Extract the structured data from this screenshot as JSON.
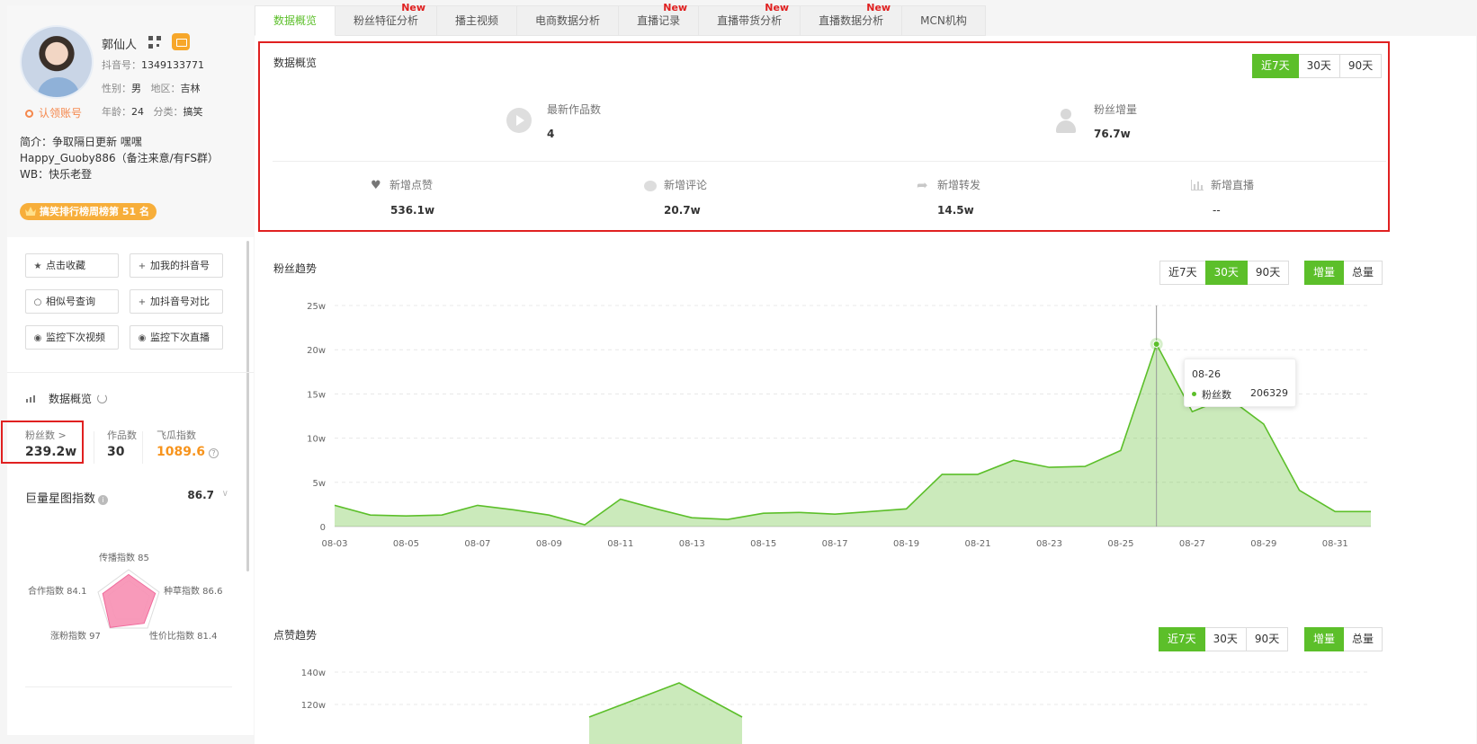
{
  "profile": {
    "name": "郭仙人",
    "douyin_id_label": "抖音号：",
    "douyin_id": "1349133771",
    "gender_label": "性别：",
    "gender": "男",
    "region_label": "地区：",
    "region": "吉林",
    "age_label": "年龄：",
    "age": "24",
    "category_label": "分类：",
    "category": "搞笑",
    "claim": "认领账号",
    "bio_lines": [
      "简介：争取隔日更新 嘿嘿",
      "Happy_Guoby886（备注来意/有FS群）",
      "WB：快乐老登"
    ],
    "rank_badge": "搞笑排行榜周榜第 51 名"
  },
  "actions": {
    "favorite": "点击收藏",
    "add_mine": "加我的抖音号",
    "similar": "相似号查询",
    "compare": "加抖音号对比",
    "monitor_video": "监控下次视频",
    "monitor_live": "监控下次直播"
  },
  "left_overview": {
    "title": "数据概览",
    "fans_label": "粉丝数 >",
    "fans_value": "239.2w",
    "works_label": "作品数",
    "works_value": "30",
    "feigua_label": "飞瓜指数",
    "feigua_value": "1089.6",
    "star_label": "巨量星图指数",
    "star_value": "86.7"
  },
  "radar": {
    "labels": {
      "spread": "传播指数 85",
      "grass": "种草指数 86.6",
      "value": "性价比指数 81.4",
      "growth": "涨粉指数 97",
      "coop": "合作指数 84.1"
    },
    "values": [
      85,
      86.6,
      81.4,
      97,
      84.1
    ]
  },
  "tabs": [
    {
      "label": "数据概览",
      "new": ""
    },
    {
      "label": "粉丝特征分析",
      "new": "New"
    },
    {
      "label": "播主视频",
      "new": ""
    },
    {
      "label": "电商数据分析",
      "new": ""
    },
    {
      "label": "直播记录",
      "new": "New"
    },
    {
      "label": "直播带货分析",
      "new": "New"
    },
    {
      "label": "直播数据分析",
      "new": "New"
    },
    {
      "label": "MCN机构",
      "new": ""
    }
  ],
  "overview": {
    "title": "数据概览",
    "ranges": [
      "近7天",
      "30天",
      "90天"
    ],
    "latest_works_label": "最新作品数",
    "latest_works_value": "4",
    "fans_growth_label": "粉丝增量",
    "fans_growth_value": "76.7w",
    "likes_label": "新增点赞",
    "likes_value": "536.1w",
    "comments_label": "新增评论",
    "comments_value": "20.7w",
    "shares_label": "新增转发",
    "shares_value": "14.5w",
    "live_label": "新增直播",
    "live_value": "--"
  },
  "fans_trend": {
    "title": "粉丝趋势",
    "ranges": [
      "近7天",
      "30天",
      "90天"
    ],
    "modes": [
      "增量",
      "总量"
    ]
  },
  "likes_trend": {
    "title": "点赞趋势",
    "ranges": [
      "近7天",
      "30天",
      "90天"
    ],
    "modes": [
      "增量",
      "总量"
    ]
  },
  "tooltip": {
    "date": "08-26",
    "series": "粉丝数",
    "value": "206329"
  },
  "chart_data": [
    {
      "type": "area",
      "title": "粉丝趋势",
      "series": [
        {
          "name": "粉丝数",
          "values": [
            24000,
            13000,
            12000,
            13000,
            24000,
            19000,
            13000,
            2000,
            31000,
            20000,
            10000,
            8000,
            15000,
            16000,
            14000,
            17000,
            20000,
            59000,
            59000,
            75000,
            67000,
            68000,
            86000,
            206329,
            130000,
            146000,
            116000,
            41000,
            17000,
            17000
          ]
        }
      ],
      "x": [
        "08-03",
        "08-04",
        "08-05",
        "08-06",
        "08-07",
        "08-08",
        "08-09",
        "08-10",
        "08-11",
        "08-12",
        "08-13",
        "08-14",
        "08-15",
        "08-16",
        "08-17",
        "08-18",
        "08-19",
        "08-20",
        "08-21",
        "08-22",
        "08-23",
        "08-24",
        "08-25",
        "08-26",
        "08-27",
        "08-28",
        "08-29",
        "08-30",
        "08-31",
        "09-01"
      ],
      "x_tick_labels": [
        "08-03",
        "08-05",
        "08-07",
        "08-09",
        "08-11",
        "08-13",
        "08-15",
        "08-17",
        "08-19",
        "08-21",
        "08-23",
        "08-25",
        "08-27",
        "08-29",
        "08-31"
      ],
      "y_tick_labels": [
        "0",
        "5w",
        "10w",
        "15w",
        "20w",
        "25w"
      ],
      "ylim": [
        0,
        250000
      ],
      "grid": true,
      "color": "#5cbf2a"
    },
    {
      "type": "area",
      "title": "点赞趋势",
      "y_tick_labels": [
        "120w",
        "140w"
      ],
      "color": "#5cbf2a"
    }
  ],
  "colors": {
    "accent": "#5cbf2a",
    "highlight": "#e02020",
    "orange": "#f7941d"
  }
}
